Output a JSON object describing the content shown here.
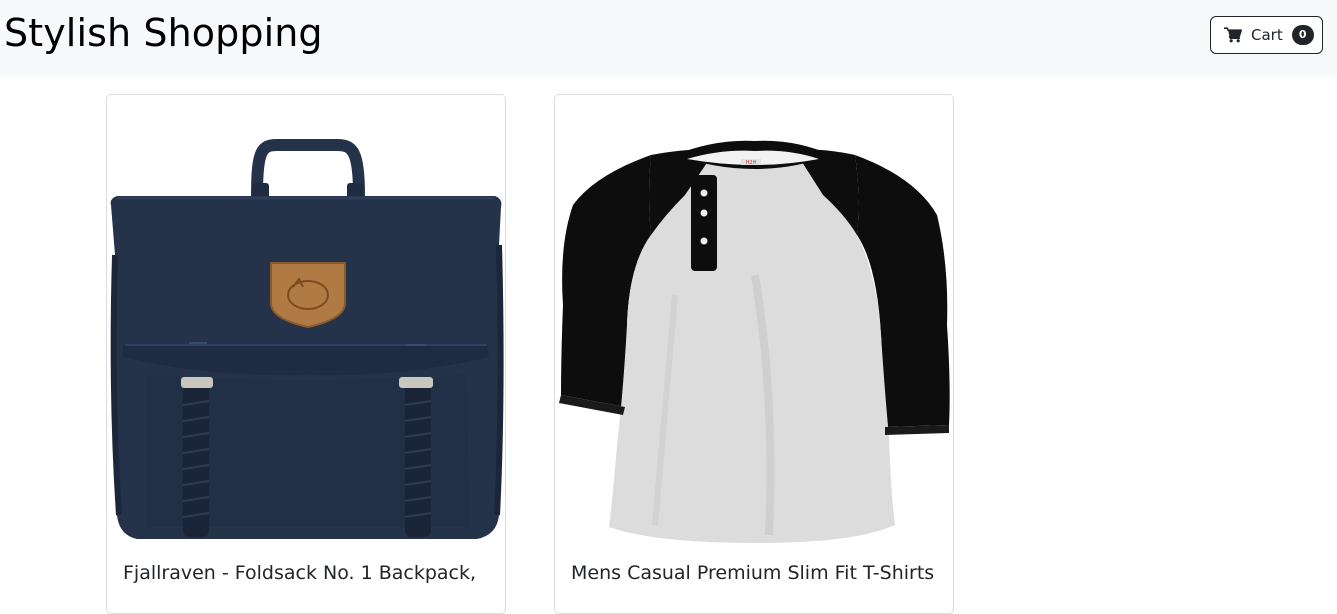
{
  "header": {
    "brand": "Stylish Shopping",
    "cart_label": "Cart",
    "cart_count": "0",
    "cart_icon": "shopping-cart-icon"
  },
  "products": [
    {
      "title": "Fjallraven - Foldsack No. 1 Backpack,",
      "image": "navy-backpack-image"
    },
    {
      "title": "Mens Casual Premium Slim Fit T-Shirts",
      "image": "raglan-henley-shirt-image"
    }
  ],
  "colors": {
    "navbar_bg": "#f8f9fa",
    "text": "#212529",
    "badge_bg": "#212529",
    "backpack_navy": "#24324a",
    "patch_leather": "#b07a44",
    "shirt_gray": "#dcdcdc",
    "shirt_sleeves": "#0d0d0d"
  }
}
